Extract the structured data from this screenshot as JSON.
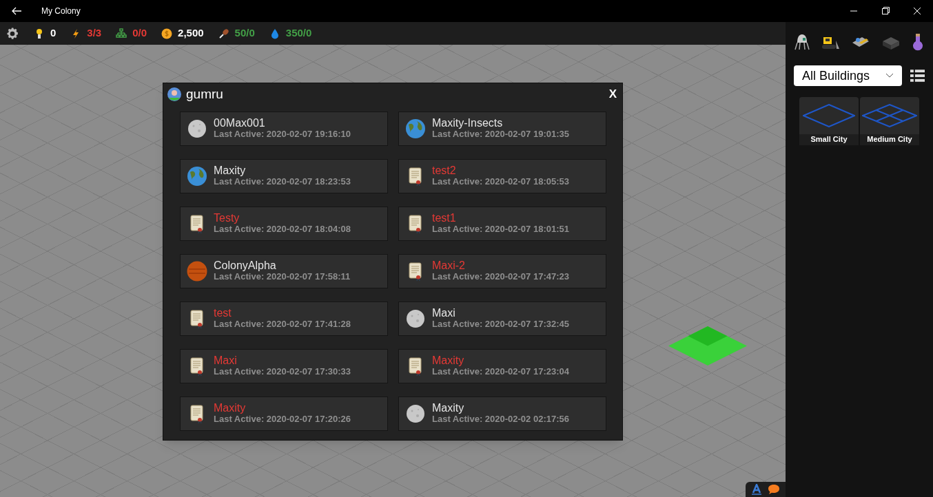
{
  "window": {
    "title": "My Colony"
  },
  "resources": [
    {
      "kind": "bulb",
      "value": "0",
      "color": "#ffffff"
    },
    {
      "kind": "bolt",
      "value": "3/3",
      "color": "#e53935"
    },
    {
      "kind": "network",
      "value": "0/0",
      "color": "#e53935"
    },
    {
      "kind": "coin",
      "value": "2,500",
      "color": "#ffffff"
    },
    {
      "kind": "food",
      "value": "50/0",
      "color": "#43a047"
    },
    {
      "kind": "water",
      "value": "350/0",
      "color": "#43a047"
    }
  ],
  "dialog": {
    "title": "gumru",
    "close": "X",
    "colonies": [
      {
        "name": "00Max001",
        "last_active": "Last Active: 2020-02-07 19:16:10",
        "kind": "moon",
        "color": "#e6e6e6"
      },
      {
        "name": "Maxity-Insects",
        "last_active": "Last Active: 2020-02-07 19:01:35",
        "kind": "earth",
        "color": "#e6e6e6"
      },
      {
        "name": "Maxity",
        "last_active": "Last Active: 2020-02-07 18:23:53",
        "kind": "earth",
        "color": "#e6e6e6"
      },
      {
        "name": "test2",
        "last_active": "Last Active: 2020-02-07 18:05:53",
        "kind": "scroll",
        "color": "#e53935"
      },
      {
        "name": "Testy",
        "last_active": "Last Active: 2020-02-07 18:04:08",
        "kind": "scroll",
        "color": "#e53935"
      },
      {
        "name": "test1",
        "last_active": "Last Active: 2020-02-07 18:01:51",
        "kind": "scroll",
        "color": "#e53935"
      },
      {
        "name": "ColonyAlpha",
        "last_active": "Last Active: 2020-02-07 17:58:11",
        "kind": "mars",
        "color": "#e6e6e6"
      },
      {
        "name": "Maxi-2",
        "last_active": "Last Active: 2020-02-07 17:47:23",
        "kind": "scroll",
        "color": "#e53935"
      },
      {
        "name": "test",
        "last_active": "Last Active: 2020-02-07 17:41:28",
        "kind": "scroll",
        "color": "#e53935"
      },
      {
        "name": "Maxi",
        "last_active": "Last Active: 2020-02-07 17:32:45",
        "kind": "moon",
        "color": "#e6e6e6"
      },
      {
        "name": "Maxi",
        "last_active": "Last Active: 2020-02-07 17:30:33",
        "kind": "scroll",
        "color": "#e53935"
      },
      {
        "name": "Maxity",
        "last_active": "Last Active: 2020-02-07 17:23:04",
        "kind": "scroll",
        "color": "#e53935"
      },
      {
        "name": "Maxity",
        "last_active": "Last Active: 2020-02-07 17:20:26",
        "kind": "scroll",
        "color": "#e53935"
      },
      {
        "name": "Maxity",
        "last_active": "Last Active: 2020-02-02 02:17:56",
        "kind": "moon",
        "color": "#e6e6e6"
      }
    ]
  },
  "side_panel": {
    "filter": "All Buildings",
    "buildings": [
      {
        "name": "Small City",
        "kind": "small"
      },
      {
        "name": "Medium City",
        "kind": "medium"
      }
    ]
  }
}
